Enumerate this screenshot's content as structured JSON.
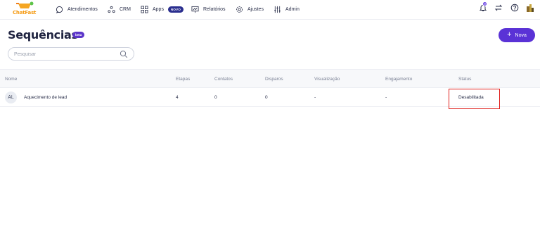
{
  "app": {
    "logo_text": "ChatFast"
  },
  "nav": {
    "atendimentos": "Atendimentos",
    "crm": "CRM",
    "apps": "Apps",
    "apps_badge": "NOVO",
    "relatorios": "Relatórios",
    "ajustes": "Ajustes",
    "admin": "Admin"
  },
  "header_right": {
    "notification_count": "0"
  },
  "page": {
    "title": "Sequências",
    "beta_badge": "beta",
    "new_button": "Nova"
  },
  "search": {
    "placeholder": "Pesquisar",
    "value": ""
  },
  "table": {
    "columns": {
      "nome": "Nome",
      "etapas": "Etapas",
      "contatos": "Contatos",
      "disparos": "Disparos",
      "visualizacao": "Visualização",
      "engajamento": "Engajamento",
      "status": "Status"
    },
    "rows": [
      {
        "initials": "AL",
        "nome": "Aquecimento de lead",
        "etapas": "4",
        "contatos": "0",
        "disparos": "0",
        "visualizacao": "-",
        "engajamento": "-",
        "status": "Desabilitada"
      }
    ]
  },
  "colors": {
    "primary": "#5a32d6",
    "badge_novo": "#2b2f8f",
    "highlight": "#e0201c",
    "logo": "#f59a12"
  }
}
